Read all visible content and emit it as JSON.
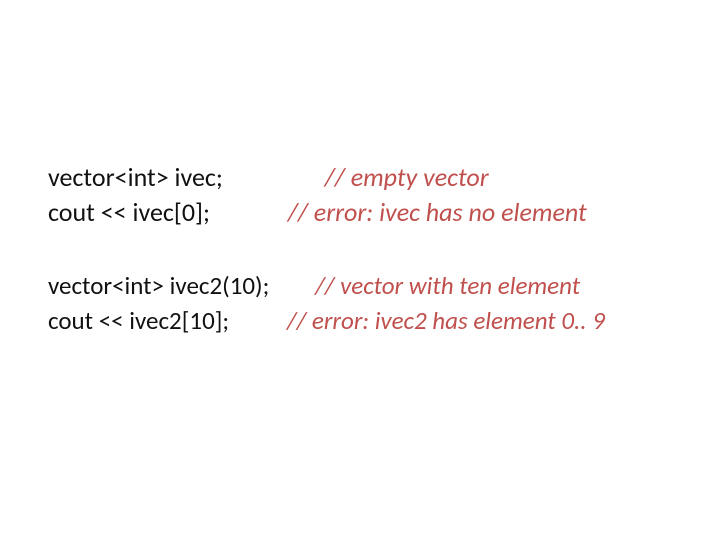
{
  "block1": {
    "line1": {
      "code": "vector<int> ivec;",
      "comment": "// empty vector"
    },
    "line2": {
      "code": "cout << ivec[0];",
      "comment": "// error: ivec has no element"
    }
  },
  "block2": {
    "line1": {
      "code": "vector<int> ivec2(10);",
      "comment": "// vector with ten element"
    },
    "line2": {
      "code": "cout << ivec2[10];",
      "comment": "// error: ivec2 has element 0.. 9"
    }
  }
}
